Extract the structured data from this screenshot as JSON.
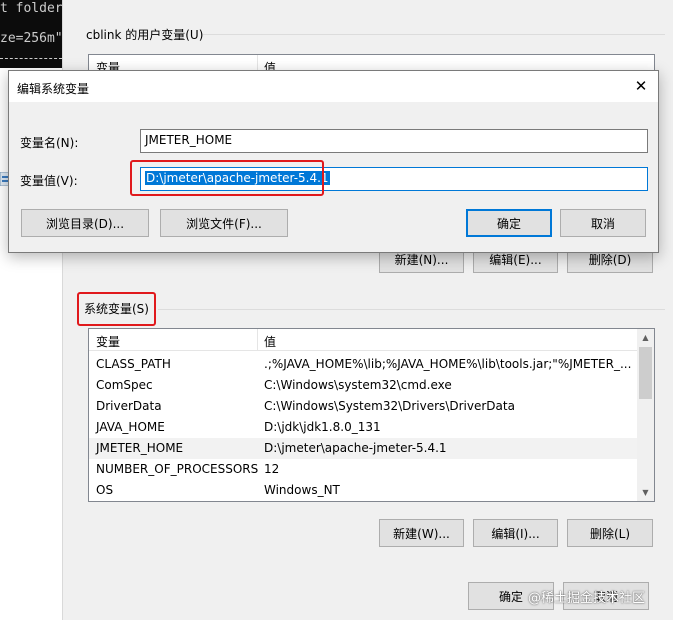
{
  "terminal": {
    "line1": "t folder",
    "line2": "ze=256m\""
  },
  "env_window": {
    "user_group_label": "cblink 的用户变量(U)",
    "user_list": {
      "columns": [
        "变量",
        "值"
      ]
    },
    "user_buttons": {
      "new": "新建(N)...",
      "edit": "编辑(E)...",
      "delete": "删除(D)"
    },
    "system_group_label": "系统变量(S)",
    "system_list": {
      "columns": [
        "变量",
        "值"
      ],
      "rows": [
        {
          "name": "CLASS_PATH",
          "value": ".;%JAVA_HOME%\\lib;%JAVA_HOME%\\lib\\tools.jar;\"%JMETER_..."
        },
        {
          "name": "ComSpec",
          "value": "C:\\Windows\\system32\\cmd.exe"
        },
        {
          "name": "DriverData",
          "value": "C:\\Windows\\System32\\Drivers\\DriverData"
        },
        {
          "name": "JAVA_HOME",
          "value": "D:\\jdk\\jdk1.8.0_131"
        },
        {
          "name": "JMETER_HOME",
          "value": "D:\\jmeter\\apache-jmeter-5.4.1"
        },
        {
          "name": "NUMBER_OF_PROCESSORS",
          "value": "12"
        },
        {
          "name": "OS",
          "value": "Windows_NT"
        }
      ]
    },
    "system_buttons": {
      "new": "新建(W)...",
      "edit": "编辑(I)...",
      "delete": "删除(L)"
    },
    "footer_buttons": {
      "ok": "确定",
      "cancel": "取消"
    },
    "watermark": "@稀土掘金技术社区"
  },
  "dialog": {
    "title": "编辑系统变量",
    "close_glyph": "✕",
    "name_label": "变量名(N):",
    "name_value": "JMETER_HOME",
    "value_label": "变量值(V):",
    "value_value": "D:\\jmeter\\apache-jmeter-5.4.1",
    "browse_dir": "浏览目录(D)...",
    "browse_file": "浏览文件(F)...",
    "ok": "确定",
    "cancel": "取消"
  },
  "colors": {
    "highlight_box": "#e0191c",
    "selection": "#0078d7"
  }
}
